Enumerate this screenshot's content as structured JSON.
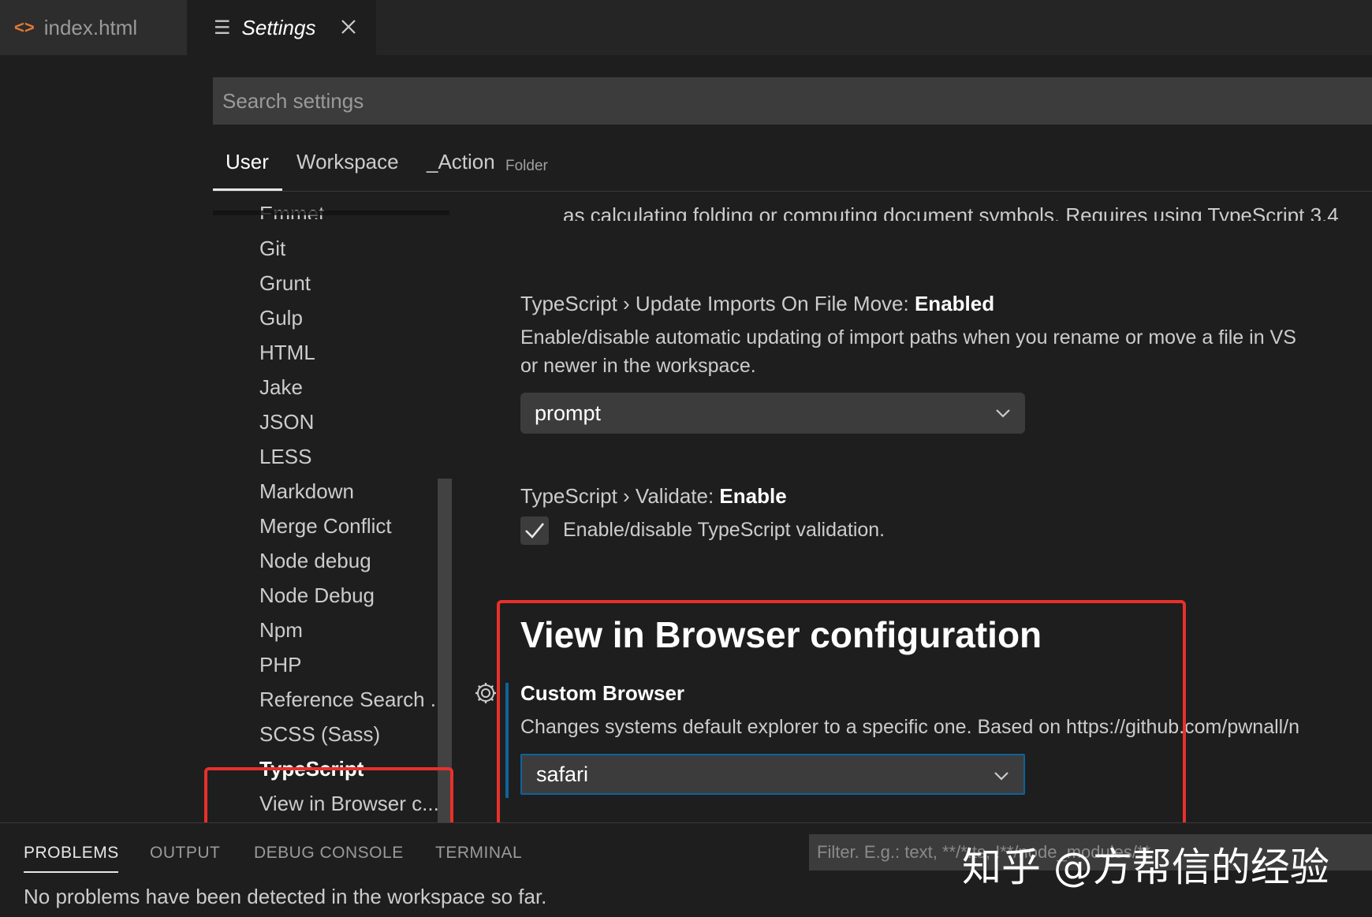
{
  "tabs": {
    "index": {
      "label": "index.html",
      "icon": "code-icon"
    },
    "settings": {
      "label": "Settings",
      "icon": "list-icon"
    }
  },
  "search": {
    "placeholder": "Search settings"
  },
  "scopes": {
    "user": "User",
    "workspace": "Workspace",
    "action": "_Action",
    "folder": "Folder"
  },
  "toc": {
    "items": [
      "Emmet",
      "Git",
      "Grunt",
      "Gulp",
      "HTML",
      "Jake",
      "JSON",
      "LESS",
      "Markdown",
      "Merge Conflict",
      "Node debug",
      "Node Debug",
      "Npm",
      "PHP",
      "Reference Search ...",
      "SCSS (Sass)",
      "TypeScript",
      "View in Browser c..."
    ]
  },
  "content": {
    "clipped_text": "as calculating folding or computing document symbols. Requires using TypeScript 3.4",
    "update_imports": {
      "prefix": "TypeScript › Update Imports On File Move: ",
      "name": "Enabled",
      "desc_line1": "Enable/disable automatic updating of import paths when you rename or move a file in VS",
      "desc_line2": "or newer in the workspace.",
      "value": "prompt"
    },
    "validate": {
      "prefix": "TypeScript › Validate: ",
      "name": "Enable",
      "desc": "Enable/disable TypeScript validation.",
      "checked": true
    },
    "view_in_browser": {
      "section_title": "View in Browser configuration",
      "setting_name": "Custom Browser",
      "desc": "Changes systems default explorer to a specific one. Based on https://github.com/pwnall/n",
      "value": "safari"
    }
  },
  "panel": {
    "tabs": [
      "PROBLEMS",
      "OUTPUT",
      "DEBUG CONSOLE",
      "TERMINAL"
    ],
    "filter_placeholder": "Filter. E.g.: text, **/*.ts, !**/node_modules/**",
    "message": "No problems have been detected in the workspace so far."
  },
  "watermark": "知乎 @方帮信的经验",
  "colors": {
    "accent_focus": "#0e639c",
    "highlight_box": "#e8302b",
    "code_icon": "#e37933"
  }
}
